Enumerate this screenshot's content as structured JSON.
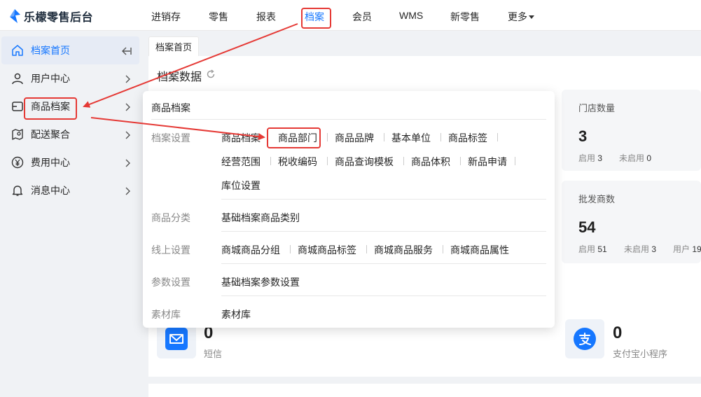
{
  "app": {
    "title": "乐檬零售后台"
  },
  "topnav": {
    "items": [
      {
        "label": "进销存"
      },
      {
        "label": "零售"
      },
      {
        "label": "报表"
      },
      {
        "label": "档案"
      },
      {
        "label": "会员"
      },
      {
        "label": "WMS"
      },
      {
        "label": "新零售"
      },
      {
        "label": "更多"
      }
    ],
    "active_index": 3
  },
  "sidebar": {
    "items": [
      {
        "label": "档案首页",
        "icon": "home-icon"
      },
      {
        "label": "用户中心",
        "icon": "user-icon"
      },
      {
        "label": "商品档案",
        "icon": "product-icon"
      },
      {
        "label": "配送聚合",
        "icon": "map-icon"
      },
      {
        "label": "费用中心",
        "icon": "yen-icon"
      },
      {
        "label": "消息中心",
        "icon": "bell-icon"
      }
    ]
  },
  "tabs": [
    {
      "label": "档案首页"
    }
  ],
  "main": {
    "section_title": "档案数据",
    "cards": [
      {
        "label": "门店数量",
        "value": "3",
        "sub": [
          {
            "k": "启用",
            "v": "3"
          },
          {
            "k": "未启用",
            "v": "0"
          }
        ]
      },
      {
        "label": "批发商数",
        "value": "54",
        "sub": [
          {
            "k": "启用",
            "v": "51"
          },
          {
            "k": "未启用",
            "v": "3"
          },
          {
            "k": "用户",
            "v": "19"
          }
        ]
      }
    ],
    "tiles": [
      {
        "value": "0",
        "label": "短信",
        "icon": "mail-icon"
      },
      {
        "value": "0",
        "label": "支付宝小程序",
        "icon": "alipay-icon"
      }
    ]
  },
  "dropdown": {
    "title": "商品档案",
    "groups": [
      {
        "category": "档案设置",
        "links": [
          "商品档案",
          "商品部门",
          "商品品牌",
          "基本单位",
          "商品标签",
          "经营范围",
          "税收编码",
          "商品查询模板",
          "商品体积",
          "新品申请",
          "库位设置"
        ]
      },
      {
        "category": "商品分类",
        "links": [
          "基础档案商品类别"
        ]
      },
      {
        "category": "线上设置",
        "links": [
          "商城商品分组",
          "商城商品标签",
          "商城商品服务",
          "商城商品属性"
        ]
      },
      {
        "category": "参数设置",
        "links": [
          "基础档案参数设置"
        ]
      },
      {
        "category": "素材库",
        "links": [
          "素材库"
        ]
      }
    ]
  },
  "colors": {
    "accent": "#1677ff",
    "annotation": "#e53935"
  }
}
